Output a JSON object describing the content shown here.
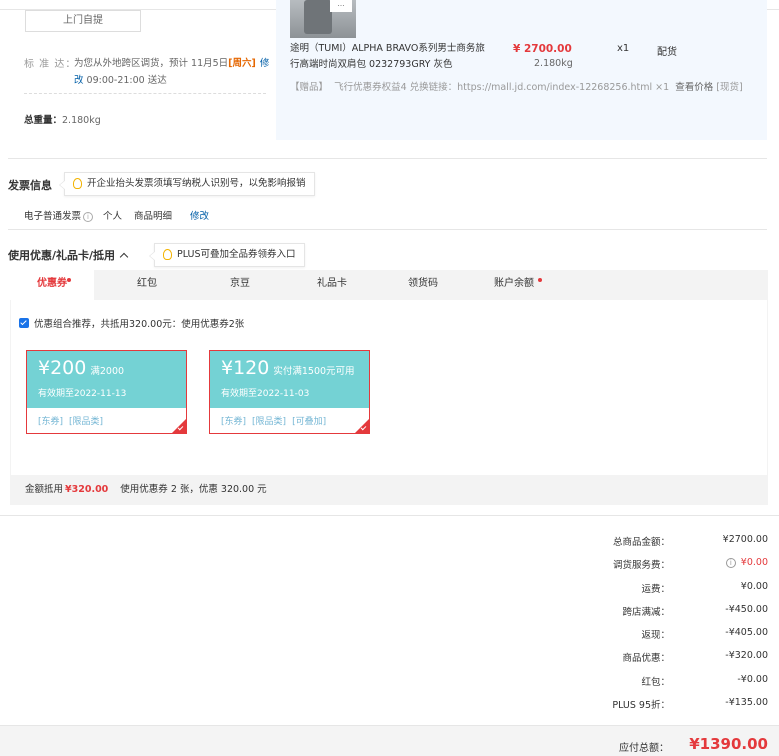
{
  "shipping": {
    "pickup_button": "上门自提",
    "standard_label": "标 准 达：",
    "standard_text_before": "为您从外地跨区调货，预计 11月5日",
    "standard_highlight": "[周六]",
    "standard_time": " 09:00-21:00 送达",
    "modify": "修改",
    "weight_label": "总重量：",
    "weight_value": "2.180kg"
  },
  "product": {
    "thumb_tag": "…",
    "name": "途明（TUMI）ALPHA BRAVO系列男士商务旅行高端时尚双肩包 0232793GRY 灰色",
    "price": "¥ 2700.00",
    "qty": "x1",
    "stock": "配货",
    "weight": "2.180kg",
    "gift_label": "【赠品】",
    "gift_text": "飞行优惠券权益4 兑换链接：https://mall.jd.com/index-12268256.html ×1",
    "gift_link": "查看价格",
    "gift_stock": "[现货]"
  },
  "invoice": {
    "title": "发票信息",
    "tip": "开企业抬头发票须填写纳税人识别号，以免影响报销",
    "type": "电子普通发票",
    "info_icon": "i",
    "person": "个人",
    "content": "商品明细",
    "modify": "修改"
  },
  "coupons": {
    "title": "使用优惠/礼品卡/抵用",
    "tip": "PLUS可叠加全品券领券入口",
    "tabs": [
      {
        "label": "优惠券",
        "dot": true
      },
      {
        "label": "红包",
        "dot": false
      },
      {
        "label": "京豆",
        "dot": false
      },
      {
        "label": "礼品卡",
        "dot": false
      },
      {
        "label": "领货码",
        "dot": false
      },
      {
        "label": "账户余额",
        "dot": true
      }
    ],
    "combo_text": "优惠组合推荐，共抵用320.00元：使用优惠券2张",
    "cards": [
      {
        "amount": "¥200",
        "condition": "满2000",
        "expiry": "有效期至2022-11-13",
        "tags": [
          "[东券]",
          "[限品类]"
        ]
      },
      {
        "amount": "¥120",
        "condition": "实付满1500元可用",
        "expiry": "有效期至2022-11-03",
        "tags": [
          "[东券]",
          "[限品类]",
          "[可叠加]"
        ]
      }
    ],
    "deduct_label": "金额抵用",
    "deduct_value": "¥320.00",
    "deduct_text": "使用优惠券 2 张，优惠 320.00 元"
  },
  "summary": {
    "rows": [
      {
        "label": "总商品金额：",
        "value": "¥2700.00"
      },
      {
        "label": "调货服务费：",
        "value": "¥0.00"
      },
      {
        "label": "运费：",
        "value": "¥0.00"
      },
      {
        "label": "跨店满减：",
        "value": "-¥450.00"
      },
      {
        "label": "返现：",
        "value": "-¥405.00"
      },
      {
        "label": "商品优惠：",
        "value": "-¥320.00"
      },
      {
        "label": "红包：",
        "value": "-¥0.00"
      },
      {
        "label": "PLUS 95折：",
        "value": "-¥135.00"
      }
    ],
    "pay_label": "应付总额：",
    "pay_value": "¥1390.00"
  },
  "colors": {
    "accent_red": "#e4393c",
    "coupon_teal": "#74d2d4",
    "link_blue": "#005ea7",
    "product_bg": "#f3f8fe"
  }
}
